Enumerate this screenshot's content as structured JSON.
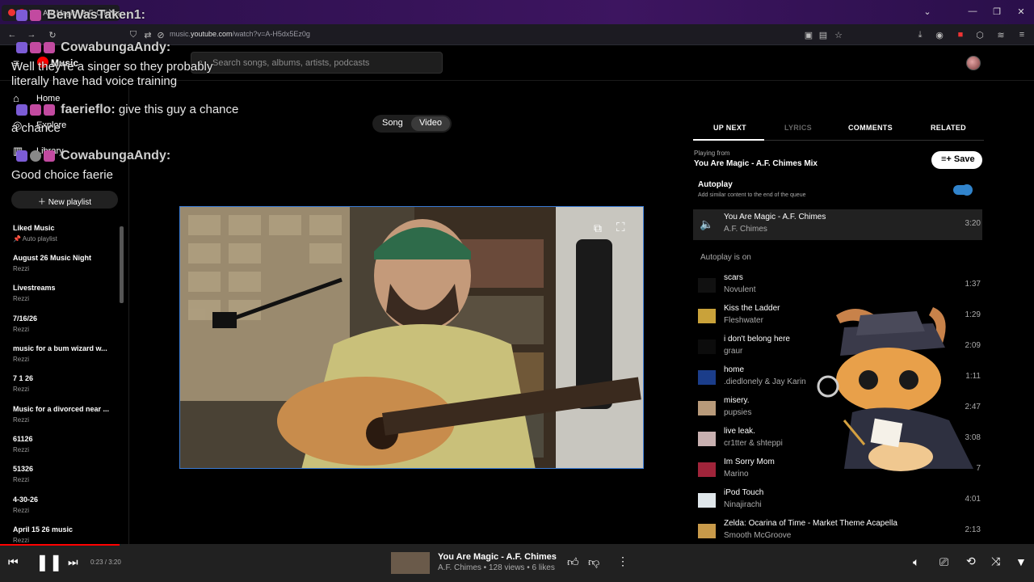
{
  "browser": {
    "tab_title": "You Are Magic - A.F. Chimes",
    "url_prefix": "music.",
    "url_domain": "youtube.com",
    "url_path": "/watch?v=A-H5dx5Ez0g"
  },
  "header": {
    "logo_label": "Music",
    "search_placeholder": "Search songs, albums, artists, podcasts"
  },
  "sidebar": {
    "nav": [
      {
        "label": "Home"
      },
      {
        "label": "Explore"
      },
      {
        "label": "Library"
      }
    ],
    "new_playlist_label": "New playlist",
    "playlists": [
      {
        "title": "Liked Music",
        "subtitle": "Auto playlist"
      },
      {
        "title": "August 26 Music Night",
        "subtitle": "Rezzi"
      },
      {
        "title": "Livestreams",
        "subtitle": "Rezzi"
      },
      {
        "title": "7/16/26",
        "subtitle": "Rezzi"
      },
      {
        "title": "music for a bum wizard w...",
        "subtitle": "Rezzi"
      },
      {
        "title": "7 1 26",
        "subtitle": "Rezzi"
      },
      {
        "title": "Music for a divorced near ...",
        "subtitle": "Rezzi"
      },
      {
        "title": "61126",
        "subtitle": "Rezzi"
      },
      {
        "title": "51326",
        "subtitle": "Rezzi"
      },
      {
        "title": "4-30-26",
        "subtitle": "Rezzi"
      },
      {
        "title": "April 15 26 music",
        "subtitle": "Rezzi"
      }
    ]
  },
  "chat_overlay": [
    {
      "name": "BenWasTaken1:",
      "message": ""
    },
    {
      "name": "CowabungaAndy:",
      "message": "Well they're a singer so they probably literally have had voice training"
    },
    {
      "name": "faerieflo:",
      "message": "give this guy a chance"
    },
    {
      "name": "CowabungaAndy:",
      "message": "Good choice faerie"
    }
  ],
  "mode_toggle": {
    "song": "Song",
    "video": "Video",
    "selected": "Video"
  },
  "right_panel": {
    "tabs": [
      "UP NEXT",
      "LYRICS",
      "COMMENTS",
      "RELATED"
    ],
    "selected_tab": "UP NEXT",
    "playing_from_label": "Playing from",
    "playing_from": "You Are Magic - A.F. Chimes Mix",
    "save_label": "Save",
    "autoplay_title": "Autoplay",
    "autoplay_desc": "Add similar content to the end of the queue",
    "autoplay_enabled": true,
    "current": {
      "title": "You Are Magic - A.F. Chimes",
      "artist": "A.F. Chimes",
      "duration": "3:20"
    },
    "autoplay_on_label": "Autoplay is on",
    "queue": [
      {
        "title": "scars",
        "artist": "Novulent",
        "duration": "1:37"
      },
      {
        "title": "Kiss the Ladder",
        "artist": "Fleshwater",
        "duration": "1:29"
      },
      {
        "title": "i don't belong here",
        "artist": "graur",
        "duration": "2:09"
      },
      {
        "title": "home",
        "artist": ".diedlonely & Jay Karin",
        "duration": "1:11"
      },
      {
        "title": "misery.",
        "artist": "pupsies",
        "duration": "2:47"
      },
      {
        "title": "live leak.",
        "artist": "cr1tter & shteppi",
        "duration": "3:08"
      },
      {
        "title": "Im Sorry Mom",
        "artist": "Marino",
        "duration": "7"
      },
      {
        "title": "iPod Touch",
        "artist": "Ninajirachi",
        "duration": "4:01"
      },
      {
        "title": "Zelda: Ocarina of Time - Market Theme Acapella",
        "artist": "Smooth McGroove",
        "duration": "2:13"
      }
    ]
  },
  "player": {
    "time": "0:23 / 3:20",
    "progress": 0.115,
    "title": "You Are Magic - A.F. Chimes",
    "meta": "A.F. Chimes • 128 views • 6 likes"
  },
  "colors": {
    "accent": "#3ea6ff",
    "progress": "#ff0000",
    "selection_border": "#3a7bd5"
  }
}
